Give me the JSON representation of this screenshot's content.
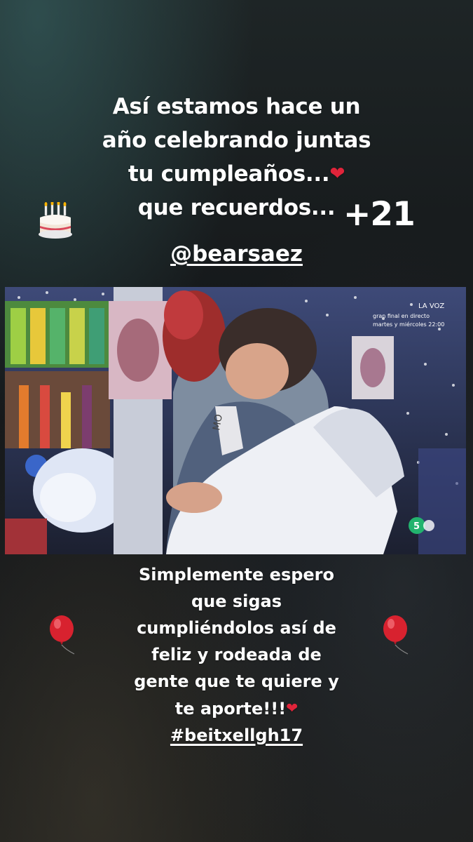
{
  "story": {
    "top_caption": {
      "line1": "Así estamos hace un",
      "line2": "año celebrando juntas",
      "line3": "tu cumpleaños...",
      "line4": "que recuerdos..."
    },
    "heart_glyph": "❤",
    "mention": "@bearsaez",
    "age_sticker": "+21",
    "photo_overlay": {
      "channel_text": "LA VOZ",
      "promo_line1": "gran final en directo",
      "promo_line2": "martes y miércoles 22:00",
      "shirt_text": "MO",
      "logo_text": "5"
    },
    "bottom_caption": {
      "line1": "Simplemente espero",
      "line2": "que sigas",
      "line3": "cumpliéndolos así de",
      "line4": "feliz y rodeada de",
      "line5": "gente que te quiere y",
      "line6": "te aporte!!!"
    },
    "hashtag": "#beitxellgh17",
    "stickers": {
      "cake": "birthday-cake-icon",
      "balloon": "red-balloon-icon"
    },
    "colors": {
      "text": "#ffffff",
      "heart": "#e0243a",
      "balloon": "#d8222f"
    }
  }
}
